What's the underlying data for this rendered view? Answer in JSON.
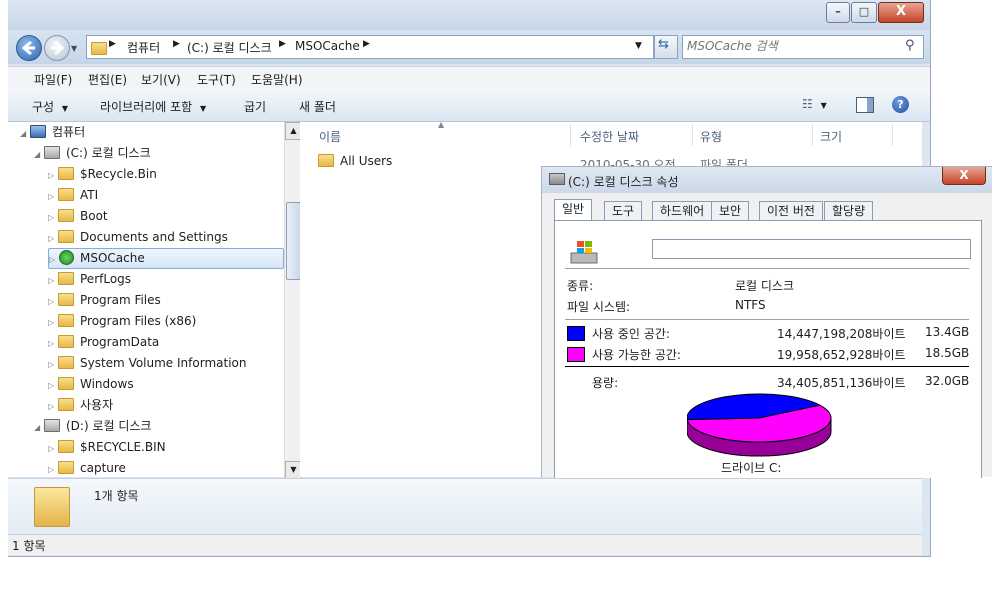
{
  "explorer": {
    "nav": {
      "breadcrumb": [
        "컴퓨터",
        "(C:) 로컬 디스크",
        "MSOCache"
      ],
      "search_placeholder": "MSOCache 검색"
    },
    "menubar": [
      "파일(F)",
      "편집(E)",
      "보기(V)",
      "도구(T)",
      "도움말(H)"
    ],
    "commandbar": {
      "organize": "구성",
      "include_library": "라이브러리에 포함",
      "burn": "굽기",
      "new_folder": "새 폴더"
    },
    "tree": [
      {
        "label": "컴퓨터",
        "expanded": true
      },
      {
        "label": "(C:) 로컬 디스크",
        "expanded": true
      },
      {
        "label": "$Recycle.Bin"
      },
      {
        "label": "ATI"
      },
      {
        "label": "Boot"
      },
      {
        "label": "Documents and Settings"
      },
      {
        "label": "MSOCache",
        "selected": true
      },
      {
        "label": "PerfLogs"
      },
      {
        "label": "Program Files"
      },
      {
        "label": "Program Files (x86)"
      },
      {
        "label": "ProgramData"
      },
      {
        "label": "System Volume Information"
      },
      {
        "label": "Windows"
      },
      {
        "label": "사용자"
      },
      {
        "label": "(D:) 로컬 디스크",
        "expanded": true
      },
      {
        "label": "$RECYCLE.BIN"
      },
      {
        "label": "capture"
      }
    ],
    "columns": [
      "이름",
      "수정한 날짜",
      "유형",
      "크기"
    ],
    "files": [
      {
        "name": "All Users",
        "date": "2010-05-30 오전...",
        "type": "파일 폴더"
      }
    ],
    "details_text": "1개 항목",
    "status_text": "1 항목"
  },
  "properties": {
    "title": "(C:) 로컬 디스크 속성",
    "close_label": "X",
    "tabs": [
      "일반",
      "도구",
      "하드웨어",
      "보안",
      "이전 버전",
      "할당량"
    ],
    "name_value": "",
    "type_label": "종류:",
    "type_value": "로컬 디스크",
    "fs_label": "파일 시스템:",
    "fs_value": "NTFS",
    "used": {
      "label": "사용 중인 공간:",
      "bytes": "14,447,198,208바이트",
      "gb": "13.4GB",
      "color": "#0000ff"
    },
    "free": {
      "label": "사용 가능한 공간:",
      "bytes": "19,958,652,928바이트",
      "gb": "18.5GB",
      "color": "#ff00ff"
    },
    "capacity": {
      "label": "용량:",
      "bytes": "34,405,851,136바이트",
      "gb": "32.0GB"
    },
    "drive_label": "드라이브 C:",
    "used_fraction": 0.42
  }
}
